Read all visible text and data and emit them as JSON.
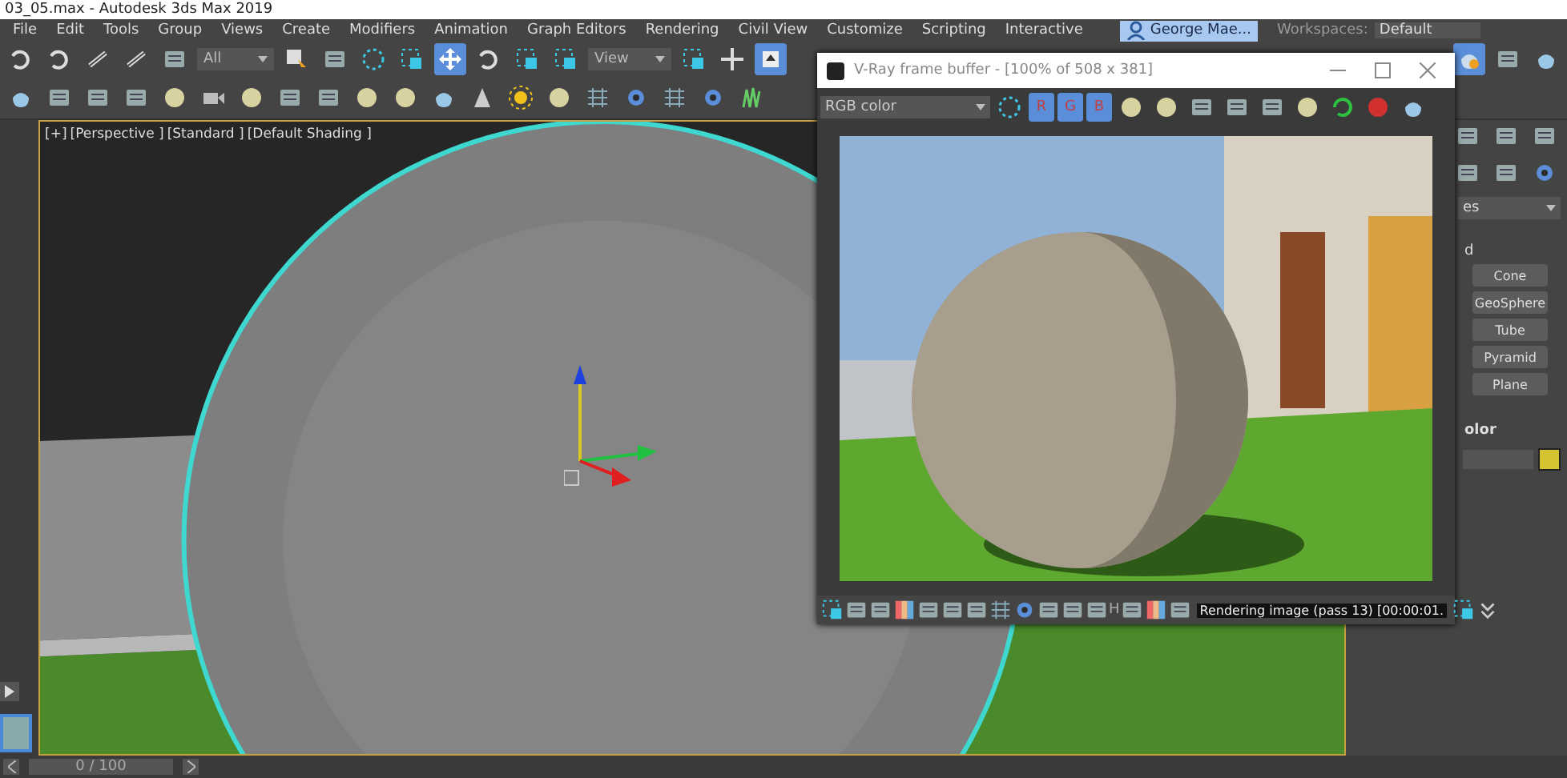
{
  "window": {
    "title": "03_05.max - Autodesk 3ds Max 2019"
  },
  "menu": [
    "File",
    "Edit",
    "Tools",
    "Group",
    "Views",
    "Create",
    "Modifiers",
    "Animation",
    "Graph Editors",
    "Rendering",
    "Civil View",
    "Customize",
    "Scripting",
    "Interactive"
  ],
  "user": {
    "name": "George Mae..."
  },
  "workspaces": {
    "label": "Workspaces:",
    "value": "Default"
  },
  "toolbar": {
    "selection_filter": "All",
    "reference_coord": "View",
    "move_selected": true,
    "select_toggle_selected": true,
    "render_setup_selected": true
  },
  "viewport": {
    "labels": [
      "[+]",
      "[Perspective ]",
      "[Standard ]",
      "[Default Shading ]"
    ]
  },
  "command_panel": {
    "dropdown": "es",
    "section_label": "d",
    "buttons": [
      "Cone",
      "GeoSphere",
      "Tube",
      "Pyramid",
      "Plane"
    ],
    "color_section": "olor",
    "color": "#d4c22e"
  },
  "timeline": {
    "frame": "0 / 100"
  },
  "vfb": {
    "title": "V-Ray frame buffer - [100% of 508 x 381]",
    "channel": "RGB color",
    "channel_buttons": [
      {
        "label": "R",
        "on": true
      },
      {
        "label": "G",
        "on": true
      },
      {
        "label": "B",
        "on": true
      }
    ],
    "status_glyph": "H",
    "status": "Rendering image (pass 13) [00:00:01."
  }
}
